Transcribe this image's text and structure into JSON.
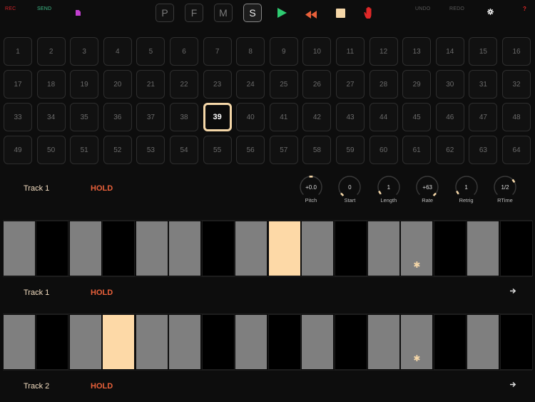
{
  "toolbar": {
    "rec_label": "REC",
    "send_label": "SEND",
    "modes": [
      "P",
      "F",
      "M",
      "S"
    ],
    "active_mode": "S",
    "undo_label": "UNDO",
    "redo_label": "REDO",
    "help_label": "?"
  },
  "colors": {
    "rec": "#d0242a",
    "send": "#3fbf8a",
    "file_icon": "#c23fd0",
    "play": "#2ecb71",
    "rewind": "#e8603a",
    "stop": "#f5d7a8",
    "hand": "#e02828",
    "selected": "#f5d7a8",
    "step_on": "#7f7f7f",
    "step_off": "#000000",
    "step_current": "#fdd9a7"
  },
  "icons": {
    "file": "file-icon",
    "play": "play-icon",
    "rewind": "rewind-icon",
    "stop": "stop-icon",
    "hand": "hand-icon",
    "settings": "gear-icon",
    "next": "arrow-right-icon"
  },
  "pattern_grid": {
    "cells": [
      "1",
      "2",
      "3",
      "4",
      "5",
      "6",
      "7",
      "8",
      "9",
      "10",
      "11",
      "12",
      "13",
      "14",
      "15",
      "16",
      "17",
      "18",
      "19",
      "20",
      "21",
      "22",
      "23",
      "24",
      "25",
      "26",
      "27",
      "28",
      "29",
      "30",
      "31",
      "32",
      "33",
      "34",
      "35",
      "36",
      "37",
      "38",
      "39",
      "40",
      "41",
      "42",
      "43",
      "44",
      "45",
      "46",
      "47",
      "48",
      "49",
      "50",
      "51",
      "52",
      "53",
      "54",
      "55",
      "56",
      "57",
      "58",
      "59",
      "60",
      "61",
      "62",
      "63",
      "64"
    ],
    "selected": "39"
  },
  "editor": {
    "track_label": "Track 1",
    "hold_label": "HOLD",
    "knobs": [
      {
        "value": "+0.0",
        "label": "Pitch",
        "level": 0.5
      },
      {
        "value": "0",
        "label": "Start",
        "level": 0.0
      },
      {
        "value": "1",
        "label": "Length",
        "level": 0.05
      },
      {
        "value": "+63",
        "label": "Rate",
        "level": 1.0
      },
      {
        "value": "1",
        "label": "Retrig",
        "level": 0.05
      },
      {
        "value": "1/2",
        "label": "RTime",
        "level": 0.7
      }
    ]
  },
  "tracks": [
    {
      "label": "Track 1",
      "hold": "HOLD",
      "steps": [
        "on",
        "off",
        "on",
        "off",
        "on",
        "on",
        "off",
        "on",
        "current",
        "on",
        "off",
        "on",
        "on-mark",
        "off",
        "on",
        "off"
      ],
      "mark": "✱"
    },
    {
      "label": "Track 2",
      "hold": "HOLD",
      "steps": [
        "on",
        "off",
        "on",
        "current",
        "on",
        "on",
        "off",
        "on",
        "off",
        "on",
        "off",
        "on",
        "on-mark",
        "off",
        "on",
        "off"
      ],
      "mark": "✱"
    }
  ]
}
